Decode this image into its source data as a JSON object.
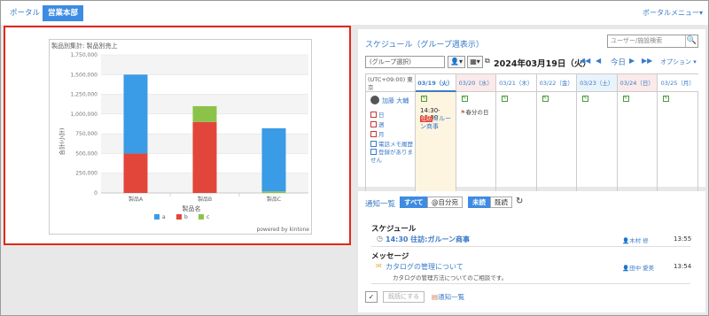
{
  "tabs": {
    "portal": "ポータル",
    "dept": "営業本部",
    "portal_menu": "ポータルメニュー▾"
  },
  "chart_data": {
    "type": "bar",
    "stacked": true,
    "title": "製品別集計: 製品別売上",
    "xlabel": "製品名",
    "ylabel": "合計(小計)",
    "categories": [
      "製品A",
      "製品B",
      "製品C"
    ],
    "series": [
      {
        "name": "a",
        "color": "#3a9be6",
        "values": [
          1000000,
          0,
          800000
        ]
      },
      {
        "name": "b",
        "color": "#e2463a",
        "values": [
          500000,
          900000,
          0
        ]
      },
      {
        "name": "c",
        "color": "#8bc34a",
        "values": [
          0,
          200000,
          20000
        ]
      }
    ],
    "ylim": [
      0,
      1750000
    ],
    "yticks": [
      "0",
      "250,000",
      "500,000",
      "750,000",
      "1,000,000",
      "1,250,000",
      "1,500,000",
      "1,750,000"
    ],
    "footer": "powered by kintone",
    "legend": "bottom"
  },
  "schedule": {
    "title": "スケジュール（グループ週表示）",
    "search_placeholder": "ユーザー/施設検索",
    "search_icon": "🔍",
    "group_select": "(グループ選択)",
    "date_title": "2024年03月19日（火）",
    "nav_prev_week": "◀◀",
    "nav_prev": "◀",
    "today": "今日",
    "nav_next": "▶",
    "nav_next_week": "▶▶",
    "option": "オプション ▾",
    "timezone": "(UTC+09:00) 東京",
    "days": [
      "03/19（火）",
      "03/20（水）",
      "03/21（木）",
      "03/22（金）",
      "03/23（土）",
      "03/24（日）",
      "03/25（月）"
    ],
    "user_name": "加藤 大輔",
    "links": [
      "日",
      "週",
      "月",
      "電話メモ履歴",
      "登録がありません"
    ],
    "event_time": "14:30-16:00",
    "event_tag": "往訪",
    "event_title": "ガルーン商事",
    "holiday": "春分の日"
  },
  "notifications": {
    "title": "通知一覧",
    "tab_all": "すべて",
    "tab_self": "@自分宛",
    "tab_unread": "未読",
    "tab_read": "既読",
    "schedule_head": "スケジュール",
    "schedule_item": "14:30 往訪:ガルーン商事",
    "schedule_user": "木村 修",
    "schedule_time": "13:55",
    "message_head": "メッセージ",
    "message_item": "カタログの管理について",
    "message_desc": "カタログの管理方法についてのご相談です。",
    "message_user": "田中 愛美",
    "message_time": "13:54",
    "mark_read": "既読にする",
    "all_link": "通知一覧"
  }
}
